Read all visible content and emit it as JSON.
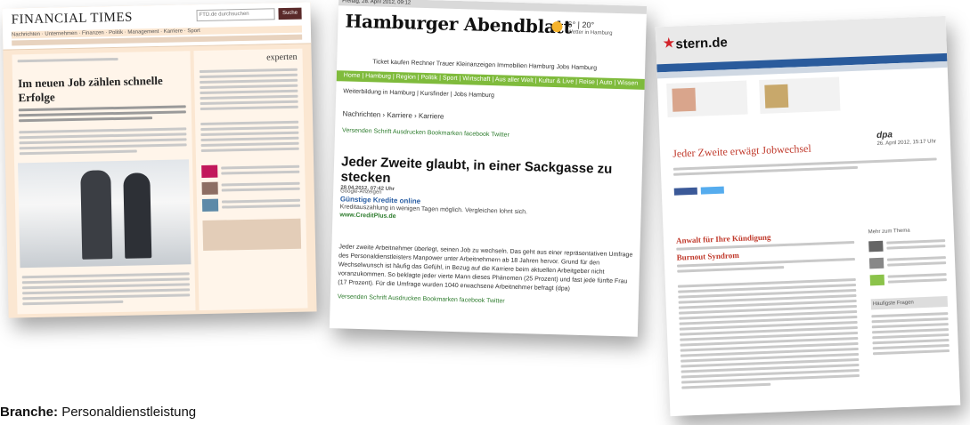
{
  "ft": {
    "logo": "FINANCIAL TIMES",
    "search_placeholder": "FTD.de durchsuchen",
    "search_button": "Suche",
    "nav": "Nachrichten · Unternehmen · Finanzen · Politik · Management · Karriere · Sport",
    "headline": "Im neuen Job zählen schnelle Erfolge",
    "experten_label": "experten"
  },
  "abendblatt": {
    "date": "Freitag, 28. April 2012, 09:12",
    "logo": "Hamburger Abendblatt",
    "temperature": "6° | 20°",
    "weather_label": "Wetter in Hamburg",
    "topnav": "Ticket kaufen   Rechner   Trauer   Kleinanzeigen   Immobilien Hamburg   Jobs Hamburg",
    "greennav": "Home | Hamburg | Region | Politik | Sport | Wirtschaft | Aus aller Welt | Kultur & Live | Reise | Auto | Wissen",
    "breadcrumb": "Weiterbildung in Hamburg | Kursfinder | Jobs Hamburg",
    "section": "Nachrichten › Karriere › Karriere",
    "tools": "Versenden   Schrift   Ausdrucken   Bookmarken   facebook   Twitter",
    "headline": "Jeder Zweite glaubt, in einer Sackgasse zu stecken",
    "headline_date": "28.04.2012, 07:42 Uhr",
    "ad_label": "Google-Anzeigen",
    "ad_title": "Günstige Kredite online",
    "ad_text": "Kreditauszahlung in wenigen Tagen möglich. Vergleichen lohnt sich.",
    "ad_url": "www.CreditPlus.de",
    "body": "Jeder zweite Arbeitnehmer überlegt, seinen Job zu wechseln. Das geht aus einer repräsentativen Umfrage des Personaldienstleisters Manpower unter Arbeitnehmern ab 18 Jahren hervor. Grund für den Wechselwunsch ist häufig das Gefühl, in Bezug auf die Karriere beim aktuellen Arbeitgeber nicht voranzukommen. So beklagte jeder vierte Mann dieses Phänomen (25 Prozent) und fast jede fünfte Frau (17 Prozent). Für die Umfrage wurden 1040 erwachsene Arbeitnehmer befragt (dpa)",
    "tools_bottom": "Versenden   Schrift   Ausdrucken   Bookmarken   facebook   Twitter"
  },
  "stern": {
    "logo": "stern.de",
    "source": "dpa",
    "date": "26. April 2012, 15:17 Uhr",
    "headline": "Jeder Zweite erwägt Jobwechsel",
    "ad1": "Anwalt für Ihre Kündigung",
    "ad2": "Burnout Syndrom",
    "sidebar_title": "Mehr zum Thema",
    "related_title": "Häufigste Fragen"
  },
  "caption": {
    "label": "Branche:",
    "value": "Personaldienstleistung"
  }
}
